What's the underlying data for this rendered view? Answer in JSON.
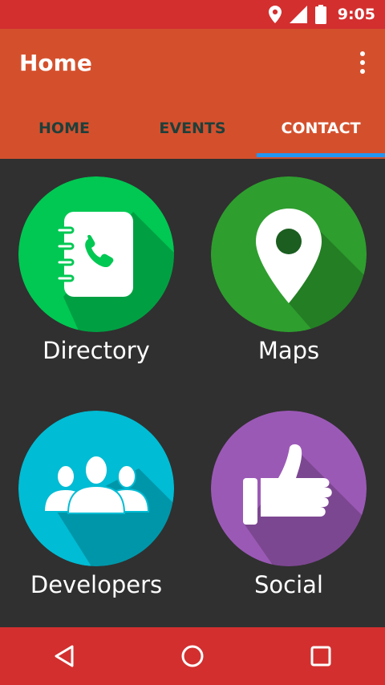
{
  "status_bar": {
    "time": "9:05",
    "icons": [
      "location-icon",
      "signal-icon",
      "battery-icon"
    ]
  },
  "app_bar": {
    "title": "Home",
    "menu_icon": "more-vert-icon",
    "color": "#d4502d"
  },
  "tabs": [
    {
      "label": "HOME",
      "active": false
    },
    {
      "label": "EVENTS",
      "active": false
    },
    {
      "label": "CONTACT",
      "active": true
    }
  ],
  "tiles": [
    {
      "label": "Directory",
      "icon": "address-book-icon",
      "color": "#00c853"
    },
    {
      "label": "Maps",
      "icon": "map-pin-icon",
      "color": "#2e9e2e"
    },
    {
      "label": "Developers",
      "icon": "group-icon",
      "color": "#00bcd4"
    },
    {
      "label": "Social",
      "icon": "thumbs-up-icon",
      "color": "#9b59b6"
    }
  ],
  "nav_bar": {
    "buttons": [
      "back-icon",
      "home-icon",
      "recents-icon"
    ],
    "color": "#d32f2f"
  },
  "colors": {
    "accent": "#2196f3",
    "background": "#303030",
    "status_bar": "#d32f2f"
  }
}
